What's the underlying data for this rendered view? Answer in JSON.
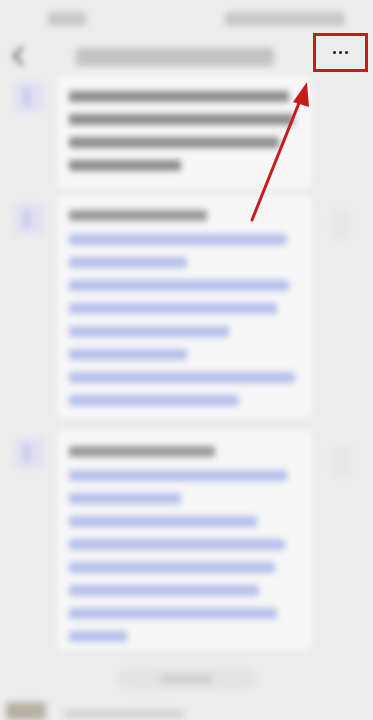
{
  "nav": {
    "back_icon": "chevron-left-icon",
    "more_icon": "more-horizontal-icon",
    "more_label": "..."
  },
  "annotation": {
    "highlight_color": "#c41d1d",
    "arrow_icon": "arrow-up-right-icon"
  },
  "colors": {
    "background": "#ececec",
    "bubble": "#f7f7f7",
    "link_text": "#b6c0ea"
  }
}
